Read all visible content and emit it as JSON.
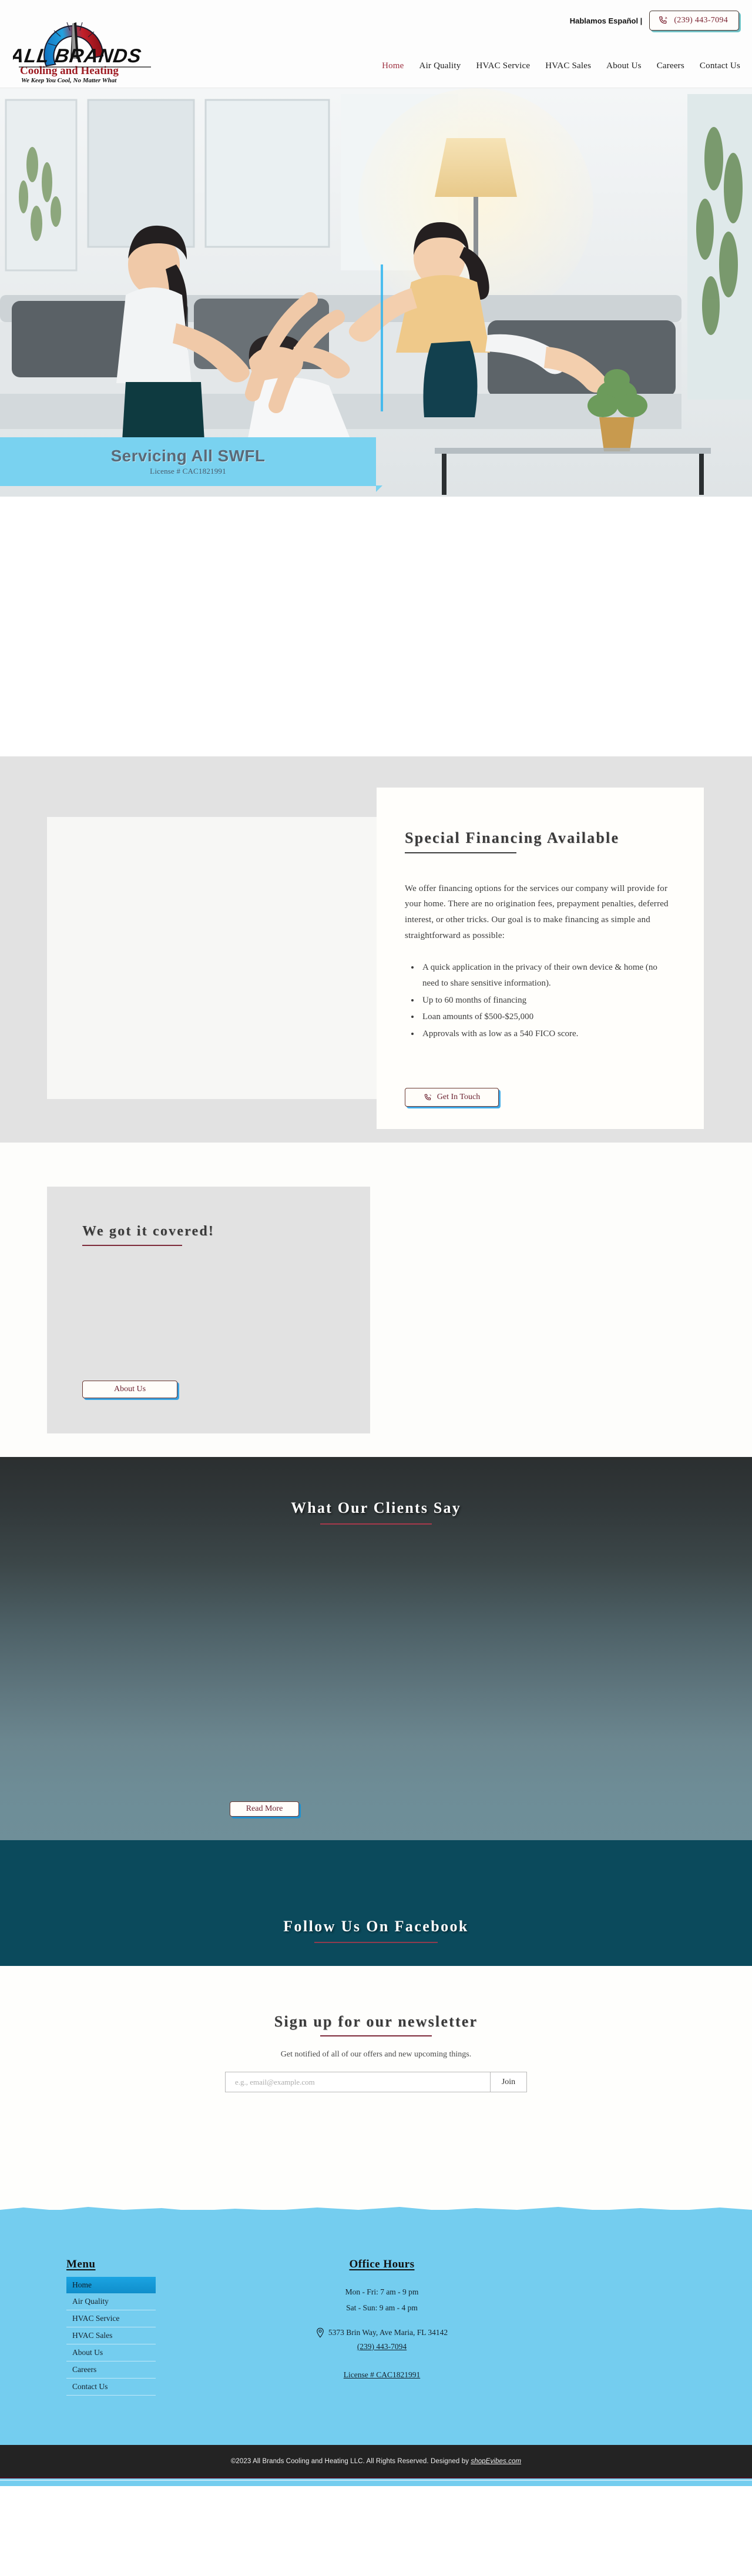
{
  "header": {
    "logo": {
      "brand_line1": "ALL BRANDS",
      "brand_line2": "Cooling and Heating",
      "tagline": "We Keep You Cool, No Matter What",
      "icon": "gauge-logo-icon"
    },
    "habla_label": "Hablamos Español |",
    "phone_label": "(239) 443-7094",
    "phone_icon": "phone-ring-icon",
    "nav": [
      {
        "label": "Home",
        "active": true
      },
      {
        "label": "Air Quality",
        "active": false
      },
      {
        "label": "HVAC Service",
        "active": false
      },
      {
        "label": "HVAC Sales",
        "active": false
      },
      {
        "label": "About Us",
        "active": false
      },
      {
        "label": "Careers",
        "active": false
      },
      {
        "label": "Contact Us",
        "active": false
      }
    ]
  },
  "hero": {
    "banner_title": "Servicing All SWFL",
    "banner_subtitle": "License # CAC1821991",
    "banner_color": "#79d2f0",
    "image_alt": "family-on-couch-living-room-photo"
  },
  "financing": {
    "title": "Special Financing Available",
    "body": "We offer financing options for the services our company will provide for your home. There are no origination fees, prepayment penalties, deferred interest, or other tricks. Our goal is to make financing as simple and straightforward as possible:",
    "bullets": [
      "A quick application in the privacy of their own device & home (no need to share sensitive information).",
      "Up to 60 months of financing",
      "Loan amounts of $500-$25,000",
      "Approvals with as low as a 540 FICO score."
    ],
    "cta_label": "Get In Touch",
    "cta_icon": "phone-ring-icon",
    "background_color": "#e2e2e2",
    "image_alt": "financing-photo-placeholder"
  },
  "covered": {
    "title": "We got it covered!",
    "cta_label": "About Us",
    "card_color": "#e2e2e2",
    "rule_color": "#7d2a3a"
  },
  "testimonials": {
    "title": "What Our Clients Say",
    "cta_label": "Read More",
    "rule_color": "#a8394c"
  },
  "facebook": {
    "title": "Follow Us On Facebook",
    "background_color": "#0b4a5c",
    "rule_color": "#a8394c"
  },
  "newsletter": {
    "title": "Sign up for our newsletter",
    "subtitle": "Get notified of all of our offers and new upcoming things.",
    "email_placeholder": "e.g., email@example.com",
    "email_value": "",
    "join_label": "Join"
  },
  "footer": {
    "menu_heading": "Menu",
    "menu_items": [
      {
        "label": "Home",
        "active": true
      },
      {
        "label": "Air Quality",
        "active": false
      },
      {
        "label": "HVAC Service",
        "active": false
      },
      {
        "label": "HVAC Sales",
        "active": false
      },
      {
        "label": "About Us",
        "active": false
      },
      {
        "label": "Careers",
        "active": false
      },
      {
        "label": "Contact Us",
        "active": false
      }
    ],
    "hours_heading": "Office Hours",
    "hours_weekday": "Mon - Fri: 7 am - 9 pm",
    "hours_weekend": "Sat - Sun: 9 am - 4 pm",
    "address": "5373 Brin Way, Ave Maria, FL 34142",
    "address_icon": "map-pin-icon",
    "phone": "(239) 443-7094",
    "license": "License # CAC1821991",
    "background_color": "#74cdef"
  },
  "copyright": {
    "text": "©2023 All Brands Cooling and Heating LLC. All Rights Reserved. Designed by ",
    "designer_link": "shopEvibes.com"
  }
}
